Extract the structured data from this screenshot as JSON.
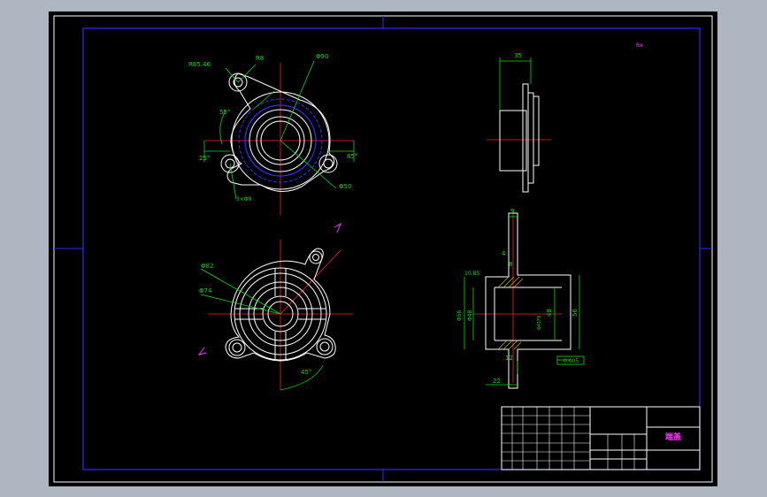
{
  "dimensions": {
    "r65": "R65.46",
    "r8": "R8",
    "d90": "Φ90",
    "d50": "Φ50",
    "holes": "3×Φ9",
    "a55": "55°",
    "a25": "25°",
    "a85": "85°",
    "side_top": "35",
    "d82": "Φ82",
    "d74": "Φ74",
    "a45": "45°",
    "v9": "9",
    "v4": "4",
    "v10": "10.85",
    "v8": "8",
    "v12": "12",
    "v22": "22",
    "v48": "48",
    "v56": "56",
    "d56": "Φ56",
    "d48": "Φ48",
    "fit": "Φ41F8",
    "tol": "0.005",
    "rough": "Ra"
  },
  "title_block": {
    "part_name": "端盖"
  },
  "colors": {
    "sheet": "#000000",
    "frame": "#ffffff",
    "border": "#2c2cff",
    "outline": "#ffffff",
    "center": "#ff2020",
    "dim": "#00e000",
    "hidden": "#3030ff",
    "note": "#ff30ff"
  }
}
